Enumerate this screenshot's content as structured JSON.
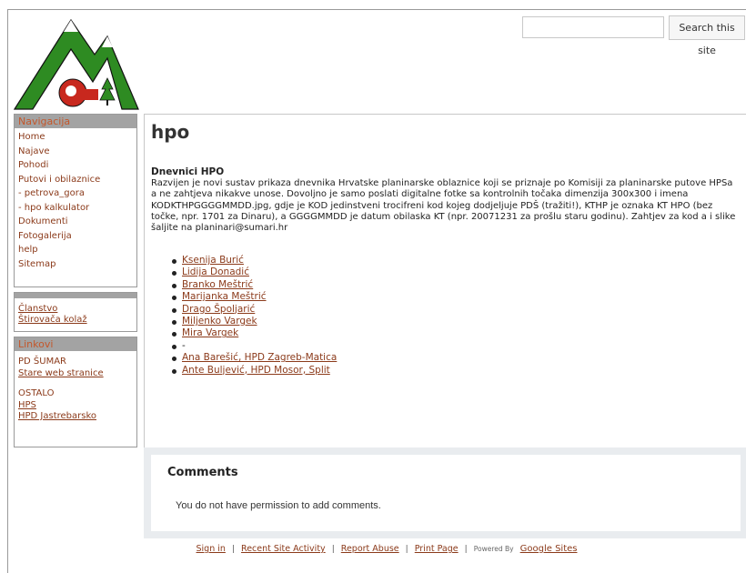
{
  "header": {
    "search_placeholder": "",
    "search_button": "Search this site"
  },
  "sidebar": {
    "nav_title": "Navigacija",
    "nav_items": [
      {
        "label": "Home",
        "link": false
      },
      {
        "label": "Najave",
        "link": false
      },
      {
        "label": "Pohodi",
        "link": false
      },
      {
        "label": "Putovi i obilaznice",
        "link": false
      },
      {
        "label": "- petrova_gora",
        "link": false
      },
      {
        "label": "- hpo kalkulator",
        "link": false
      },
      {
        "label": "Dokumenti",
        "link": false
      },
      {
        "label": "Fotogalerija",
        "link": false
      },
      {
        "label": "help",
        "link": false
      },
      {
        "label": "Sitemap",
        "link": false
      }
    ],
    "extra_items": [
      "Članstvo",
      "Štirovača kolaž"
    ],
    "links_title": "Linkovi",
    "sections": [
      {
        "heading": "PD ŠUMAR",
        "links": [
          "Stare web stranice"
        ]
      },
      {
        "heading": "OSTALO",
        "links": [
          "HPS",
          "HPD Jastrebarsko"
        ]
      }
    ]
  },
  "main": {
    "title": "hpo",
    "section_title": "Dnevnici HPO",
    "intro": "Razvijen je novi sustav prikaza dnevnika Hrvatske planinarske oblaznice koji se priznaje po Komisiji za planinarske putove HPSa a ne zahtjeva nikakve unose. Dovoljno je samo poslati digitalne fotke sa kontrolnih točaka dimenzija 300x300 i imena KODKTHPGGGGMMDD.jpg, gdje je KOD jedinstveni trocifreni kod kojeg dodjeljuje PDŠ (tražiti!), KTHP je oznaka KT HPO (bez točke, npr. 1701 za Dinaru), a GGGGMMDD je datum obilaska KT (npr. 20071231 za prošlu staru godinu). Zahtjev za kod a i slike šaljite na planinari@sumari.hr",
    "diaries": [
      {
        "label": "Ksenija Burić",
        "link": true
      },
      {
        "label": "Lidija Donadić",
        "link": true
      },
      {
        "label": "Branko Meštrić",
        "link": true
      },
      {
        "label": "Marijanka Meštrić",
        "link": true
      },
      {
        "label": "Drago Špoljarić",
        "link": true
      },
      {
        "label": "Miljenko Vargek",
        "link": true
      },
      {
        "label": "Mira Vargek",
        "link": true
      },
      {
        "label": "-",
        "link": false
      },
      {
        "label": "Ana Barešić, HPD Zagreb-Matica",
        "link": true
      },
      {
        "label": "Ante Buljević, HPD Mosor, Split",
        "link": true
      }
    ]
  },
  "comments": {
    "title": "Comments",
    "message": "You do not have permission to add comments."
  },
  "footer": {
    "sign_in": "Sign in",
    "recent_activity": "Recent Site Activity",
    "report_abuse": "Report Abuse",
    "print_page": "Print Page",
    "powered_by": "Powered By",
    "google_sites": "Google Sites",
    "separator": "|"
  },
  "colors": {
    "link": "#8b3a1a",
    "sidebar_header_bg": "#a3a3a3",
    "sidebar_header_text": "#c4572b",
    "logo_green": "#2e8b22",
    "logo_red": "#c8281e"
  }
}
